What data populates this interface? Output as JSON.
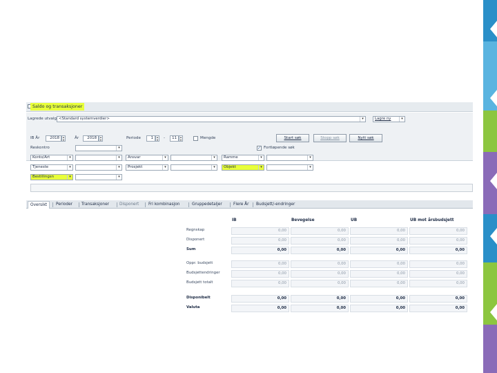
{
  "window": {
    "title": "Saldo og transaksjoner"
  },
  "saved_search": {
    "label": "Lagrede utvalg",
    "value": "<Standard systemverdier>",
    "save_new": "Lagre ny"
  },
  "ib_year": {
    "label": "IB År",
    "value": "2018"
  },
  "year": {
    "label": "År",
    "value": "2018"
  },
  "period": {
    "label": "Periode",
    "from": "1",
    "separator": "-",
    "to": "11"
  },
  "quantity_checkbox": {
    "label": "Mengde",
    "checked": false
  },
  "buttons": {
    "start": "Start søk",
    "stop": "Stopp søk",
    "new": "Nytt søk"
  },
  "continuous_checkbox": {
    "label": "Fortløpende søk",
    "checked": true
  },
  "reskontro_label": "Reskontro",
  "dimensions": {
    "konto": "Konto/Art",
    "ansvar": "Ansvar",
    "ramme": "Ramme",
    "tjeneste": "Tjeneste",
    "prosjekt": "Prosjekt",
    "objekt": "Objekt",
    "bestilling": "Bestillingsn"
  },
  "tabs": [
    "Oversikt",
    "Perioder",
    "Transaksjoner",
    "Disponert",
    "Fri kombinasjon",
    "Gruppedetaljer",
    "Flere År",
    "Budsjett/-endringer"
  ],
  "summary": {
    "columns": [
      "IB",
      "Bevegelse",
      "UB",
      "UB mot årsbudsjett"
    ],
    "rows": [
      {
        "label": "Regnskap",
        "values": [
          "0,00",
          "0,00",
          "0,00",
          "0,00"
        ],
        "bold": false
      },
      {
        "label": "Disponert",
        "values": [
          "0,00",
          "0,00",
          "0,00",
          "0,00"
        ],
        "bold": false
      },
      {
        "label": "Sum",
        "values": [
          "0,00",
          "0,00",
          "0,00",
          "0,00"
        ],
        "bold": true
      },
      {
        "label": "Oppr. budsjett",
        "values": [
          "0,00",
          "0,00",
          "0,00",
          "0,00"
        ],
        "bold": false
      },
      {
        "label": "Budsjettendringer",
        "values": [
          "0,00",
          "0,00",
          "0,00",
          "0,00"
        ],
        "bold": false
      },
      {
        "label": "Budsjett totalt",
        "values": [
          "0,00",
          "0,00",
          "0,00",
          "0,00"
        ],
        "bold": false
      },
      {
        "label": "Disponibelt",
        "values": [
          "0,00",
          "0,00",
          "0,00",
          "0,00"
        ],
        "bold": true
      },
      {
        "label": "Valuta",
        "values": [
          "0,00",
          "0,00",
          "0,00",
          "0,00"
        ],
        "bold": true
      }
    ]
  },
  "colors": {
    "highlight": "#e8ff3a",
    "stripe_blue": "#2a8fc8",
    "stripe_green": "#8cc63f",
    "stripe_purple": "#8a6bb8"
  }
}
